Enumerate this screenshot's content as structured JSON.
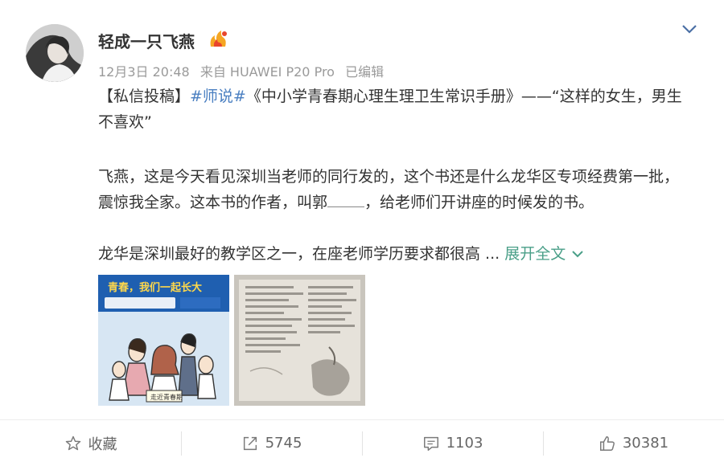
{
  "post": {
    "author_name": "轻成一只飞燕",
    "meta": {
      "date": "12月3日 20:48",
      "source": "来自 HUAWEI P20 Pro",
      "edited": "已编辑"
    },
    "paragraph1": {
      "tag": "【私信投稿】",
      "topic": "#师说#",
      "text": "《中小学青春期心理生理卫生常识手册》——“这样的女生，男生不喜欢”"
    },
    "paragraph2": {
      "text_before": "飞燕，这是今天看见深圳当老师的同行发的，这个书还是什么龙华区专项经费第一批，震惊我全家。这本书的作者，叫郭",
      "text_after": "，给老师们开讲座的时候发的书。"
    },
    "paragraph3": {
      "text": "龙华是深圳最好的教学区之一，在座老师学历要求都很高 ... ",
      "expand_label": "展开全文"
    },
    "images": [
      {
        "cover_title": "青春，我们一起长大",
        "cover_caption": "走近青春期"
      },
      {}
    ]
  },
  "actions": {
    "favorite_label": "收藏",
    "repost_count": "5745",
    "comment_count": "1103",
    "like_count": "30381"
  },
  "icons": {
    "badge": "vip-flame-badge-icon",
    "menu": "chevron-down-icon",
    "expand": "chevron-down-icon",
    "favorite": "star-icon",
    "repost": "repost-icon",
    "comment": "comment-icon",
    "like": "thumbs-up-icon"
  },
  "colors": {
    "tag": "#eb7350",
    "topic": "#4a7fc1",
    "expand": "#4a9f88",
    "meta": "#9a9a9a"
  }
}
